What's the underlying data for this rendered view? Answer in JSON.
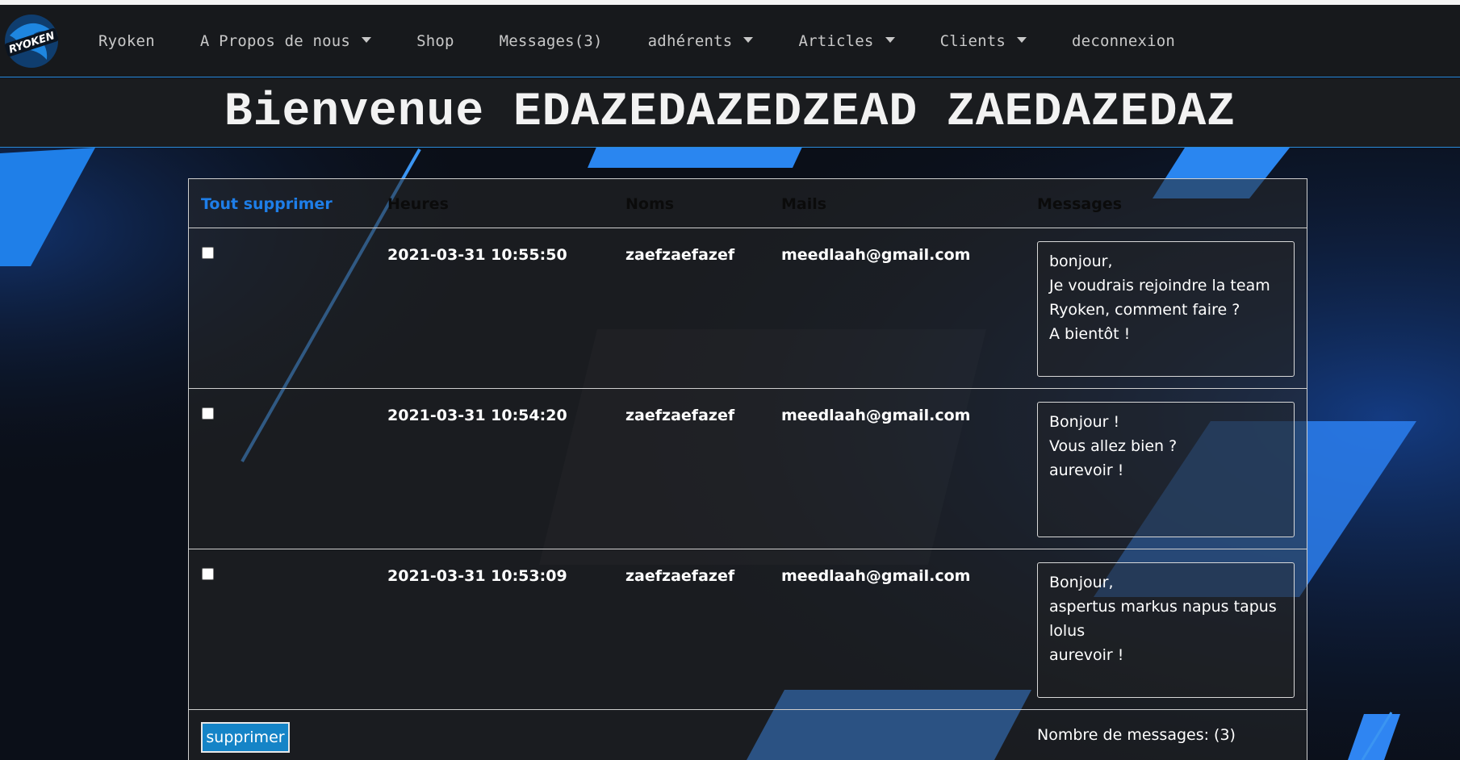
{
  "nav": {
    "logo_text": "RYOKEN",
    "items": [
      {
        "label": "Ryoken",
        "dropdown": false
      },
      {
        "label": "A Propos de nous",
        "dropdown": true
      },
      {
        "label": "Shop",
        "dropdown": false
      },
      {
        "label": "Messages(3)",
        "dropdown": false
      },
      {
        "label": "adhérents",
        "dropdown": true
      },
      {
        "label": "Articles",
        "dropdown": true
      },
      {
        "label": "Clients",
        "dropdown": true
      },
      {
        "label": "deconnexion",
        "dropdown": false
      }
    ]
  },
  "banner": {
    "title": "Bienvenue EDAZEDAZEDZEAD ZAEDAZEDAZ"
  },
  "table": {
    "headers": {
      "delete_all": "Tout supprimer",
      "hours": "Heures",
      "names": "Noms",
      "mails": "Mails",
      "messages": "Messages"
    },
    "rows": [
      {
        "checked": false,
        "time": "2021-03-31 10:55:50",
        "name": "zaefzaefazef",
        "mail": "meedlaah@gmail.com",
        "message_lines": [
          "bonjour,",
          "Je voudrais rejoindre la team",
          "Ryoken, comment faire ?",
          "A bientôt !"
        ]
      },
      {
        "checked": false,
        "time": "2021-03-31 10:54:20",
        "name": "zaefzaefazef",
        "mail": "meedlaah@gmail.com",
        "message_lines": [
          "Bonjour !",
          "Vous allez bien ?",
          "aurevoir !"
        ]
      },
      {
        "checked": false,
        "time": "2021-03-31 10:53:09",
        "name": "zaefzaefazef",
        "mail": "meedlaah@gmail.com",
        "message_lines": [
          "Bonjour,",
          "aspertus markus napus tapus",
          "lolus",
          "aurevoir !"
        ]
      }
    ],
    "delete_button": "supprimer",
    "count_label": "Nombre de messages: (3)"
  },
  "colors": {
    "accent": "#2a8ad8",
    "link": "#1e7ee8",
    "button": "#1584c7",
    "nav_bg": "#17191c"
  }
}
